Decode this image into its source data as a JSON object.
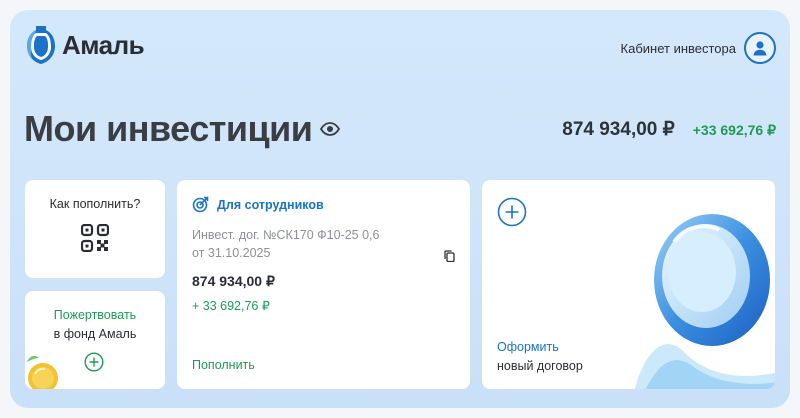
{
  "header": {
    "logo_text": "Амаль",
    "cabinet_label": "Кабинет инвестора"
  },
  "summary": {
    "title": "Мои инвестиции",
    "total_amount": "874 934,00 ₽",
    "total_gain": "+33 692,76 ₽"
  },
  "cards": {
    "topup_info": {
      "label": "Как пополнить?"
    },
    "donate": {
      "line1": "Пожертвовать",
      "line2": "в фонд Амаль"
    },
    "contract": {
      "header": "Для сотрудников",
      "name": "Инвест. дог. №СК170 Ф10-25 0,6 от 31.10.2025",
      "amount": "874 934,00 ₽",
      "gain": "+ 33 692,76 ₽",
      "topup_label": "Пополнить"
    },
    "new_contract": {
      "action": "Оформить",
      "subtitle": "новый договор"
    }
  },
  "icons": {
    "logo": "amphora-logo-icon",
    "avatar": "user-icon",
    "eye": "eye-icon",
    "qr": "qr-code-icon",
    "plus": "plus-circle-icon",
    "contract": "target-arrow-icon",
    "copy": "copy-icon"
  },
  "colors": {
    "accent_blue": "#1a73c6",
    "accent_green": "#1f9a55",
    "text_dark": "#2a2d33",
    "background": "#d0e5fa"
  }
}
